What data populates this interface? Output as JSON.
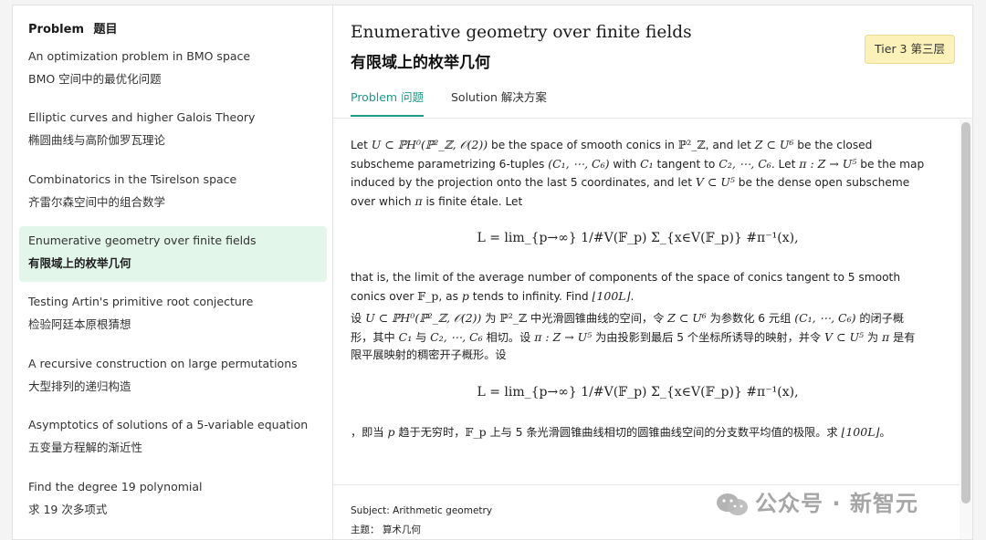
{
  "sidebar": {
    "title_en": "Problem",
    "title_zh": "题目",
    "items": [
      {
        "en": "An optimization problem in BMO space",
        "zh": "BMO 空间中的最优化问题"
      },
      {
        "en": "Elliptic curves and higher Galois Theory",
        "zh": "椭圆曲线与高阶伽罗瓦理论"
      },
      {
        "en": "Combinatorics in the Tsirelson space",
        "zh": "齐雷尔森空间中的组合数学"
      },
      {
        "en": "Enumerative geometry over finite fields",
        "zh": "有限域上的枚举几何",
        "active": true
      },
      {
        "en": "Testing Artin's primitive root conjecture",
        "zh": "检验阿廷本原根猜想"
      },
      {
        "en": "A recursive construction on large permutations",
        "zh": "大型排列的递归构造"
      },
      {
        "en": "Asymptotics of solutions of a 5-variable equation",
        "zh": "五变量方程解的渐近性"
      },
      {
        "en": "Find the degree 19 polynomial",
        "zh": "求 19 次多项式"
      }
    ]
  },
  "main": {
    "title_en": "Enumerative geometry over finite fields",
    "title_zh": "有限域上的枚举几何",
    "tier": "Tier 3  第三层",
    "tabs": [
      {
        "label": "Problem  问题",
        "active": true
      },
      {
        "label": "Solution  解决方案",
        "active": false
      }
    ],
    "content": {
      "p1_a": "Let ",
      "p1_b": " be the space of smooth conics in ",
      "p1_c": ", and let ",
      "p1_d": " be the closed subscheme parametrizing 6-tuples ",
      "p1_e": " with ",
      "p1_f": " tangent to ",
      "p1_g": ". Let ",
      "p1_h": " be the map induced by the projection onto the last 5 coordinates, and let ",
      "p1_i": " be the dense open subscheme over which ",
      "p1_j": " is finite étale. Let",
      "eq": "L = lim_{p→∞} 1/#V(𝔽_p) Σ_{x∈V(𝔽_p)} #π⁻¹(x),",
      "p2_a": "that is, the limit of the average number of components of the space of conics tangent to 5 smooth conics over ",
      "p2_b": ", as ",
      "p2_c": " tends to infinity. Find ",
      "p2_d": ".",
      "zh_1": "设 ",
      "zh_2": " 为 ",
      "zh_3": " 中光滑圆锥曲线的空间，令 ",
      "zh_4": " 为参数化 6 元组 ",
      "zh_5": " 的闭子概形，其中 ",
      "zh_6": " 与 ",
      "zh_7": " 相切。设 ",
      "zh_8": " 为由投影到最后 5 个坐标所诱导的映射，并令 ",
      "zh_9": " 为 ",
      "zh_10": " 是有限平展映射的稠密开子概形。设",
      "zh_end_a": "，即当 ",
      "zh_end_b": " 趋于无穷时，",
      "zh_end_c": " 上与 5 条光滑圆锥曲线相切的圆锥曲线空间的分支数平均值的极限。求 ",
      "zh_end_d": "。"
    },
    "math": {
      "U": "U ⊂ ℙH⁰(ℙ²_ℤ, 𝒪(2))",
      "P2Z": "ℙ²_ℤ",
      "Z": "Z ⊂ U⁶",
      "tuple": "(C₁, ⋯, C₆)",
      "C1": "C₁",
      "C2": "C₂, ⋯, C₆",
      "pi": "π : Z → U⁵",
      "V": "V ⊂ U⁵",
      "pi_s": "π",
      "Fp": "𝔽_p",
      "p": "p",
      "floor": "⌊100L⌋"
    },
    "footer": {
      "subject_label": "Subject:",
      "subject_value": "Arithmetic geometry",
      "topic_label": "主题：",
      "topic_value": "算术几何"
    },
    "watermark": "公众号 · 新智元"
  },
  "colors": {
    "accent": "#1a9b86",
    "active_bg": "#e2f6ea",
    "tier_bg": "#fcf1b9"
  }
}
